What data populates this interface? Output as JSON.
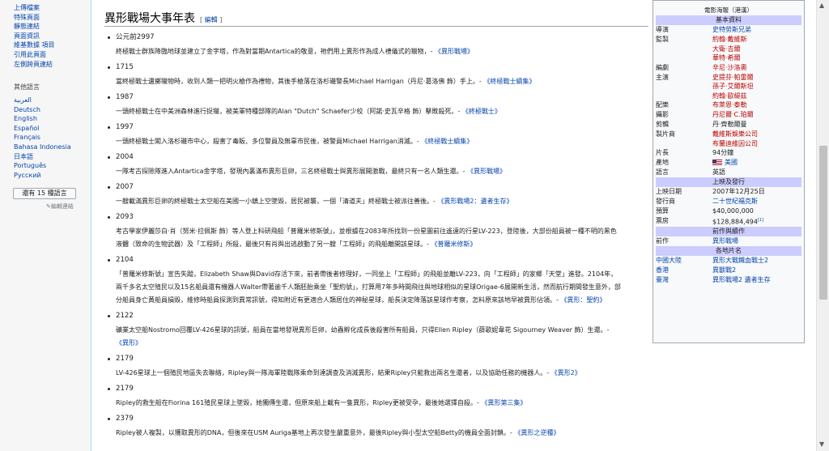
{
  "sidebar": {
    "tools": [
      "上傳檔案",
      "特殊頁面",
      "靜態連結",
      "頁面資訊",
      "維基數據 項目",
      "引用此頁面",
      "左側跨頁連結"
    ],
    "lang_title": "其他語言",
    "langs": [
      "العربية",
      "Deutsch",
      "English",
      "Español",
      "Français",
      "Bahasa Indonesia",
      "日本語",
      "Português",
      "Русский"
    ],
    "lang_button": "還有 15 種語言",
    "edit_links": "✎編輯連結"
  },
  "section": {
    "title": "異形戰場大事年表",
    "edit_open": "[ ",
    "edit_label": "編輯",
    "edit_close": " ]"
  },
  "events": [
    {
      "year": "公元前2997",
      "desc": "終極戰士群族降臨地球並建立了金字塔，作為對當期Antartica的敬意，祂們用上異形作為成人禮儀式的獵物，-",
      "ref": "《異形戰場》"
    },
    {
      "year": "1715",
      "desc": "當終極戰士遺擲獵物時，收到人類一把明火槍作為禮物，其後手槍落在洛杉磯警長Michael Harrigan（丹尼·葛洛佛 飾）手上。-",
      "ref": "《終極戰士續集》"
    },
    {
      "year": "1987",
      "desc": "一頭終極戰士在中美洲森林進行捉獵，被美軍特種部隊的Alan \"Dutch\" Schaefer少校（阿諾·史瓦辛格 飾）擊敗殺死。-",
      "ref": "《終極戰士》"
    },
    {
      "year": "1997",
      "desc": "一頭終極戰士闖入洛杉磯市中心，殺害了毒販、多位警員及無辜市民後，被警員Michael Harrigan消滅。-",
      "ref": "《終極戰士續集》"
    },
    {
      "year": "2004",
      "desc": "一隊考古探險隊進入Antartica金字塔，發現內裏滿布異形巨卵，三名終極戰士與異形展開激戰，最終只有一名人類生還。-",
      "ref": "《異形戰場》"
    },
    {
      "year": "2007",
      "desc": "一艘載滿異形巨卵的終極戰士太空船在美國一小鎮上空墜毀，居民被襲，一個「清道夫」終極戰士被派往善後。-",
      "ref": "《異形戰場2：遺者生存》"
    },
    {
      "year": "2093",
      "desc": "考古學家伊麗莎白·肖（努米·拉佩斯 飾）等人登上科研飛船「普羅米修斯號」，並根據在2083年所找到一份星圖前往遙遠的行星LV-223，登陸後，大部份船員被一種不明的黑色液體（致命的生物武器）及「工程師」所殺，最後只有肖與出逃啟動了另一艘「工程師」的飛船離開該星球。-",
      "ref": "《普羅米修斯》"
    },
    {
      "year": "2104",
      "desc": "「普羅米修斯號」宣告失蹤，Elizabeth Shaw與David存活下來，前者帶後者修理好，一同坐上「工程師」的飛船並離LV-223，向「工程師」的家鄉「天堂」進發。2104年，兩千多名太空殖民以及15名船員還有機器人Walter帶著逾千人類胚胎乘坐「聖約號」，打算用7年多時間飛往與地球相似的星球Origae-6展開新生活，然而航行期間發生意外，部分船員身亡黃船員損毀，維修時船員探測到異常訊號，得知附近有更適合人類居住的神秘星球，船長決定降落該星球作考察，怎料原來該地早被異形佔領。-",
      "ref": "《異形：聖約》"
    },
    {
      "year": "2122",
      "desc": "礦業太空船Nostromo回覆LV-426星球的訊號，船員在當地發現異形巨卵，幼蟲孵化成長後殺害所有船員，只得Ellen Ripley（薛歌妮韋花 Sigourney Weaver 飾）生還。-",
      "ref": "《異形》"
    },
    {
      "year": "2179",
      "desc": "LV-426星球上一個殖民地區失去聯絡，Ripley與一隊海軍陸戰隊乘命到達調查及消滅異形，結果Ripley只能救出兩名生還者，以及協助任務的機器人。-",
      "ref": "《異形2》"
    },
    {
      "year": "2179",
      "desc": "Ripley的救生船在Fiorina 161殖民星球上墜毀，她獨傳生還，但原來船上載有一隻異形，Ripley更被受孕，最後她選擇自殺。-",
      "ref": "《異形第三集》"
    },
    {
      "year": "2379",
      "desc": "Ripley被人複製，以獲取異形的DNA，但後來在USM Auriga基地上再次發生嚴重意外，最後Ripley與小型太空船Betty的機員全面封鎖。-",
      "ref": "《異形之逆種》"
    }
  ],
  "infobox": {
    "caption": "電影海報（港漢）",
    "basic_header": "基本資料",
    "rows": [
      {
        "k": "導演",
        "v": [
          "史特勞斯兄弟"
        ],
        "red": false
      },
      {
        "k": "監製",
        "v": [
          "約翰·戴維斯",
          "大衛·吉爾",
          "華特·希爾"
        ],
        "red": true
      },
      {
        "k": "編劇",
        "v": [
          "辛尼·沙洛奧"
        ],
        "red": true
      },
      {
        "k": "主演",
        "v": [
          "史提芬·帕雷爾",
          "孫子·艾爾斯坦",
          "約翰·歐緹茲"
        ],
        "red": true
      },
      {
        "k": "配樂",
        "v": [
          "布萊恩·泰勒"
        ],
        "red": true
      },
      {
        "k": "攝影",
        "v": [
          "丹尼爾·C.珀爾"
        ],
        "red": true
      },
      {
        "k": "剪輯",
        "v": [
          "丹·齊勒爾曼"
        ],
        "red": false,
        "plain": true
      },
      {
        "k": "製片商",
        "v": [
          "戴維斯娛樂公司",
          "布蘭迪維因公司"
        ],
        "red": true
      },
      {
        "k": "片長",
        "v": [
          "94分鐘"
        ],
        "red": false,
        "plain": true
      },
      {
        "k": "產地",
        "v": [
          "美國"
        ],
        "red": false,
        "flag": true
      },
      {
        "k": "語言",
        "v": [
          "英語"
        ],
        "red": false,
        "plain": true
      }
    ],
    "release_header": "上映及發行",
    "release_rows": [
      {
        "k": "上映日期",
        "v": [
          "2007年12月25日"
        ],
        "plain": true
      },
      {
        "k": "發行商",
        "v": [
          "二十世紀福克斯"
        ],
        "plain": false
      },
      {
        "k": "預算",
        "v": [
          "$40,000,000"
        ],
        "plain": true
      },
      {
        "k": "票房",
        "v": [
          "$128,884,494"
        ],
        "plain": true,
        "sup": "[1]"
      }
    ],
    "sequel_header": "前作與續作",
    "sequel_rows": [
      {
        "k": "前作",
        "v": [
          "異形戰場"
        ],
        "plain": false
      }
    ],
    "names_header": "各地片名",
    "names_rows": [
      {
        "k": "中國大陸",
        "v": [
          "異形大戰鐵血戰士2"
        ]
      },
      {
        "k": "香港",
        "v": [
          "異獸戰2"
        ]
      },
      {
        "k": "臺灣",
        "v": [
          "異形戰場2 遺者生存"
        ]
      }
    ]
  }
}
